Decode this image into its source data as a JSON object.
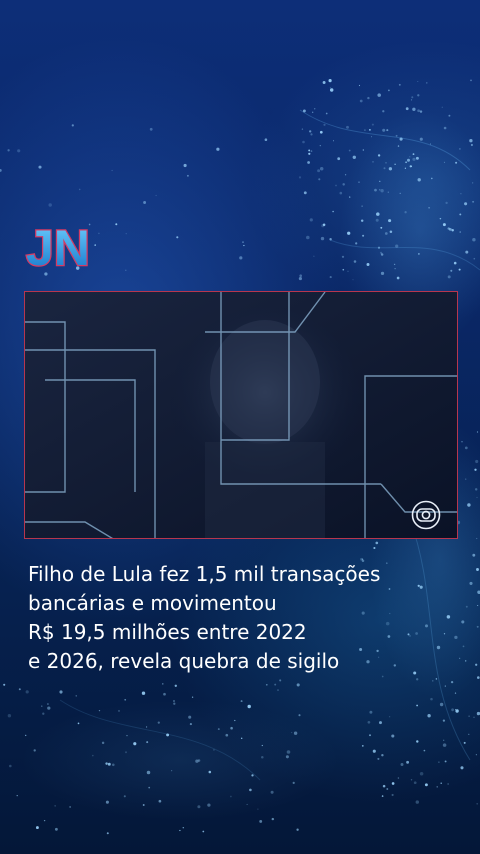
{
  "program_logo": {
    "text": "JN",
    "icon": "jn-logo",
    "fill_color": "#1e9fe0",
    "outline_color": "#d43a63"
  },
  "video": {
    "border_color": "#b7364e",
    "watermark_icon": "globo-logo-icon"
  },
  "headline": {
    "lines": [
      "Filho de Lula fez 1,5 mil transações",
      "bancárias e movimentou",
      "R$ 19,5 milhões entre 2022",
      "e 2026, revela quebra de sigilo"
    ],
    "color": "#ffffff"
  }
}
